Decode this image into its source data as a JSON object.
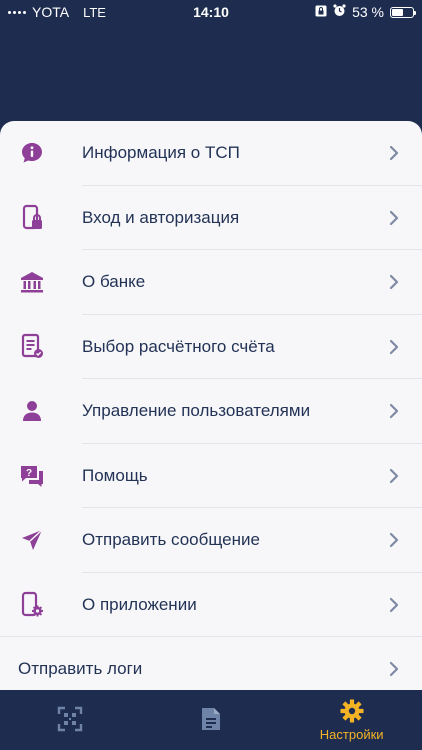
{
  "status_bar": {
    "carrier": "YOTA",
    "network": "LTE",
    "time": "14:10",
    "battery": "53 %",
    "battery_level": 0.53
  },
  "menu": {
    "items": [
      {
        "label": "Информация о ТСП",
        "icon": "info-icon"
      },
      {
        "label": "Вход и авторизация",
        "icon": "phone-lock-icon"
      },
      {
        "label": "О банке",
        "icon": "bank-icon"
      },
      {
        "label": "Выбор расчётного счёта",
        "icon": "document-check-icon"
      },
      {
        "label": "Управление пользователями",
        "icon": "user-icon"
      },
      {
        "label": "Помощь",
        "icon": "help-chat-icon"
      },
      {
        "label": "Отправить сообщение",
        "icon": "send-icon"
      },
      {
        "label": "О приложении",
        "icon": "phone-settings-icon"
      },
      {
        "label": "Отправить логи",
        "icon": ""
      }
    ]
  },
  "tab_bar": {
    "tabs": [
      {
        "label": "",
        "icon": "qr-scan-icon"
      },
      {
        "label": "",
        "icon": "document-icon"
      },
      {
        "label": "Настройки",
        "icon": "gear-icon"
      }
    ]
  },
  "colors": {
    "header_bg": "#1e2d4f",
    "icon_purple": "#8e3f97",
    "text": "#233356",
    "chevron": "#7e8aa3",
    "active_tab": "#f4b324",
    "inactive_tab": "#6f82a8"
  }
}
